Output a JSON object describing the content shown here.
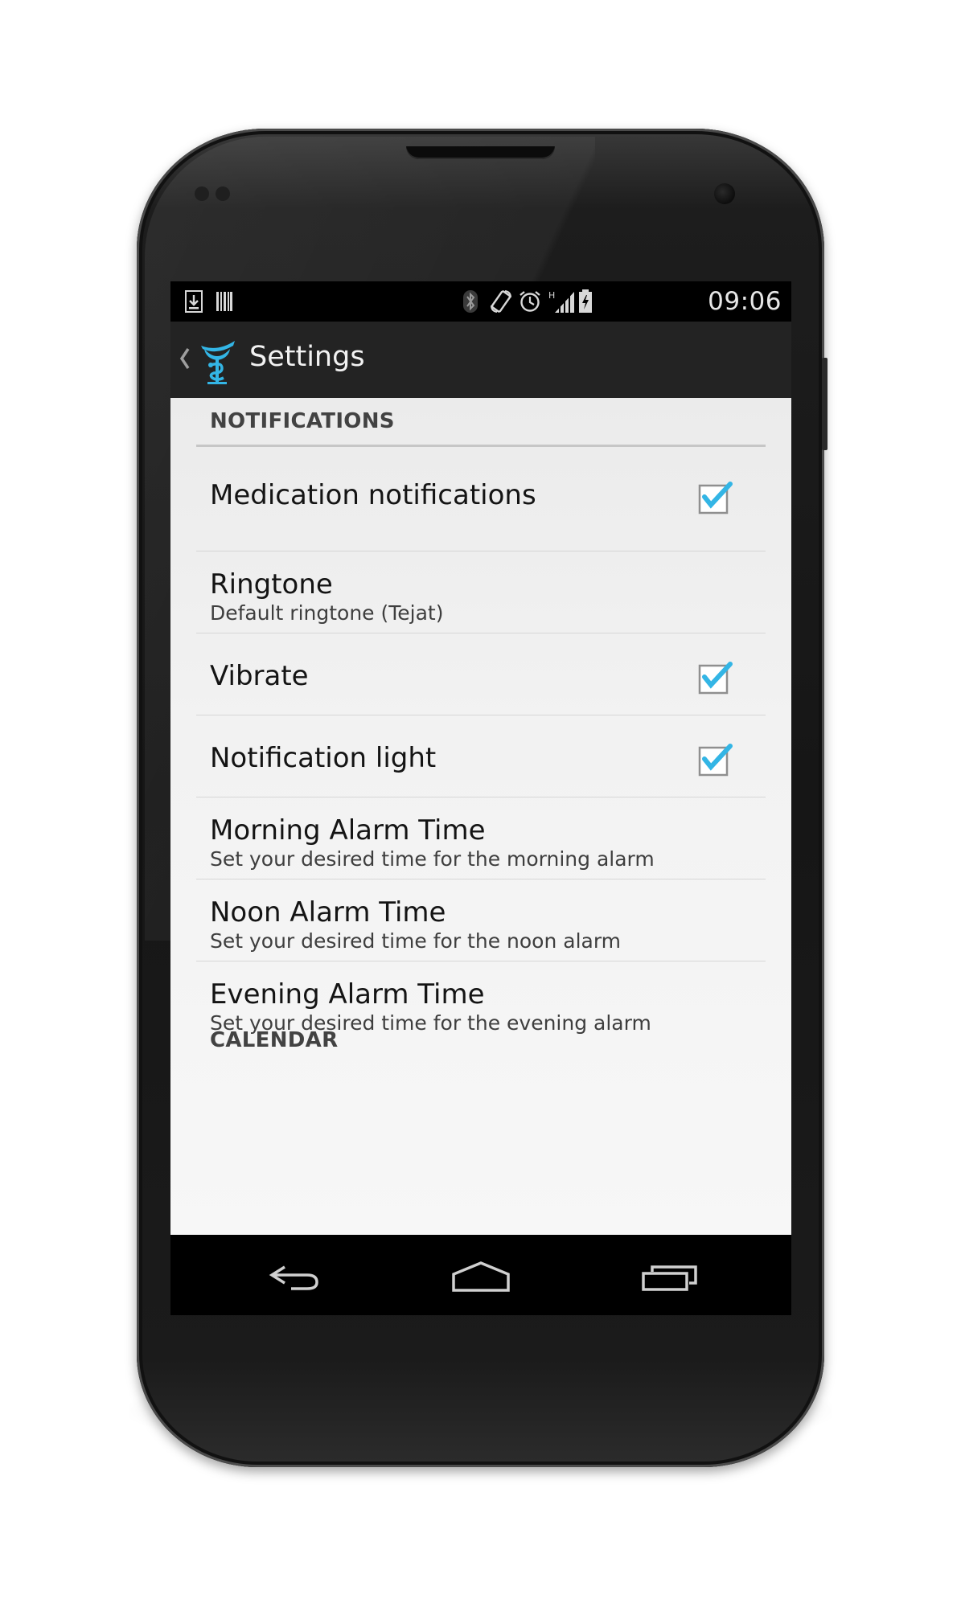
{
  "status_bar": {
    "time": "09:06",
    "left_icons": [
      "download-icon",
      "barcode-icon"
    ],
    "right_icons": [
      "bluetooth-icon",
      "rotate-icon",
      "alarm-icon",
      "signal-icon",
      "battery-charging-icon"
    ],
    "network_label": "H"
  },
  "action_bar": {
    "title": "Settings",
    "app_icon": "caduceus-icon",
    "accent": "#33b5e5"
  },
  "sections": [
    {
      "header": "NOTIFICATIONS",
      "items": [
        {
          "title": "Medication notifications",
          "summary": "",
          "checked": true
        },
        {
          "title": "Ringtone",
          "summary": "Default ringtone (Tejat)"
        },
        {
          "title": "Vibrate",
          "summary": "",
          "checked": true
        },
        {
          "title": "Notification light",
          "summary": "",
          "checked": true
        },
        {
          "title": "Morning Alarm Time",
          "summary": "Set your desired time for the morning alarm"
        },
        {
          "title": "Noon Alarm Time",
          "summary": "Set your desired time for the noon alarm"
        },
        {
          "title": "Evening Alarm Time",
          "summary": "Set your desired time for the evening alarm"
        }
      ]
    },
    {
      "header": "CALENDAR",
      "items": []
    }
  ],
  "nav_bar": {
    "buttons": [
      "back-icon",
      "home-icon",
      "recent-apps-icon"
    ]
  },
  "colors": {
    "checkbox_accent": "#33b5e5",
    "action_bar_bg": "#232323",
    "content_bg": "#f2f2f2"
  }
}
